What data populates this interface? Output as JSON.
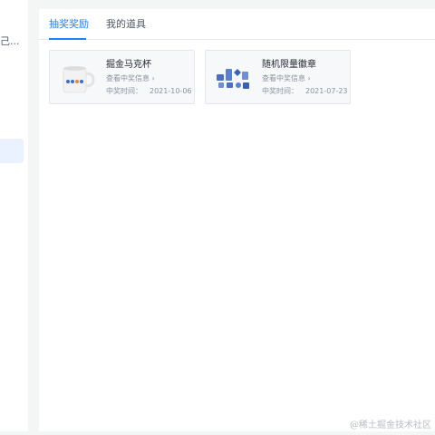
{
  "left": {
    "truncated_text": "己..."
  },
  "tabs": [
    {
      "label": "抽奖奖励"
    },
    {
      "label": "我的道具"
    }
  ],
  "cards": [
    {
      "title": "掘金马克杯",
      "link": "查看中奖信息",
      "time_label": "中奖时间：",
      "time_value": "2021-10-06",
      "icon": "mug-icon"
    },
    {
      "title": "随机限量徽章",
      "link": "查看中奖信息",
      "time_label": "中奖时间：",
      "time_value": "2021-07-23",
      "icon": "badges-icon"
    }
  ],
  "watermark": "@稀土掘金技术社区",
  "colors": {
    "accent": "#1e80ff",
    "muted": "#8a919f",
    "card_bg": "#f7f8fa"
  }
}
